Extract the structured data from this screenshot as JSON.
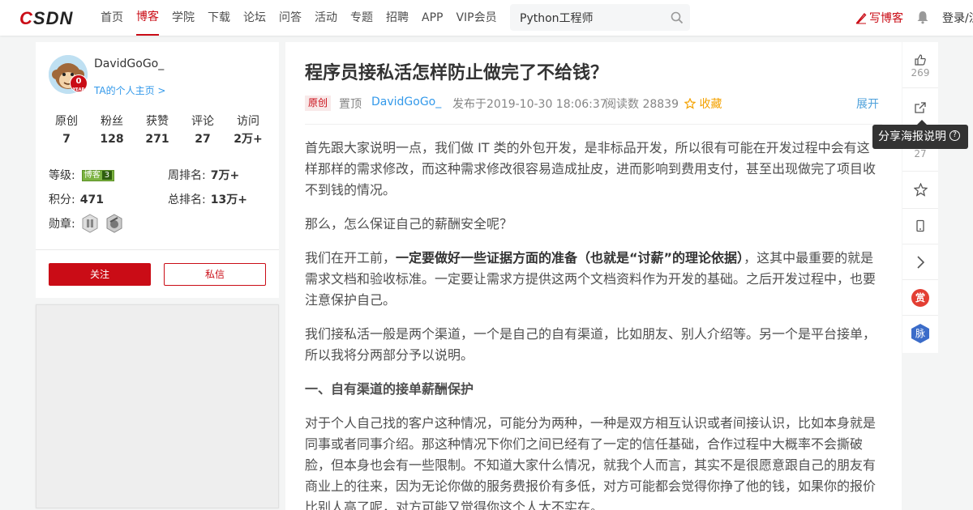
{
  "logo": {
    "text_c": "C",
    "text_sdn": "SDN"
  },
  "nav": {
    "items": [
      {
        "label": "首页"
      },
      {
        "label": "博客"
      },
      {
        "label": "学院"
      },
      {
        "label": "下载"
      },
      {
        "label": "论坛"
      },
      {
        "label": "问答"
      },
      {
        "label": "活动"
      },
      {
        "label": "专题"
      },
      {
        "label": "招聘"
      },
      {
        "label": "APP"
      },
      {
        "label": "VIP会员"
      }
    ],
    "active": "博客"
  },
  "search": {
    "value": "Python工程师"
  },
  "header": {
    "write_label": "写博客",
    "login_label": "登录/注册"
  },
  "profile": {
    "username": "DavidGoGo_",
    "homepage_link": "TA的个人主页 >",
    "year_badge": "0",
    "year_badge_sub": "YEAR",
    "stats": [
      {
        "label": "原创",
        "value": "7"
      },
      {
        "label": "粉丝",
        "value": "128"
      },
      {
        "label": "获赞",
        "value": "271"
      },
      {
        "label": "评论",
        "value": "27"
      },
      {
        "label": "访问",
        "value": "2万+"
      }
    ],
    "level_label": "等级:",
    "level_badge_text": "博客",
    "level_badge_num": "3",
    "weekly_rank_label": "周排名:",
    "weekly_rank": "7万+",
    "points_label": "积分:",
    "points": "471",
    "total_rank_label": "总排名:",
    "total_rank": "13万+",
    "medals_label": "勋章:",
    "follow_label": "关注",
    "message_label": "私信"
  },
  "article": {
    "title": "程序员接私活怎样防止做完了不给钱？",
    "tag": "原创",
    "pinned": "置顶",
    "author": "DavidGoGo_",
    "published": "发布于2019-10-30 18:06:37",
    "reads": "阅读数 28839",
    "collect": "收藏",
    "expand": "展开",
    "p1": "首先跟大家说明一点，我们做 IT 类的外包开发，是非标品开发，所以很有可能在开发过程中会有这样那样的需求修改，而这种需求修改很容易造成扯皮，进而影响到费用支付，甚至出现做完了项目收不到钱的情况。",
    "p2": "那么，怎么保证自己的薪酬安全呢？",
    "p3_pre": "我们在开工前，",
    "p3_bold": "一定要做好一些证据方面的准备（也就是“讨薪”的理论依据）",
    "p3_post": "，这其中最重要的就是需求文档和验收标准。一定要让需求方提供这两个文档资料作为开发的基础。之后开发过程中，也要注意保护自己。",
    "p4": "我们接私活一般是两个渠道，一个是自己的自有渠道，比如朋友、别人介绍等。另一个是平台接单，所以我将分两部分予以说明。",
    "heading1": "一、自有渠道的接单薪酬保护",
    "p5": "对于个人自己找的客户这种情况，可能分为两种，一种是双方相互认识或者间接认识，比如本身就是同事或者同事介绍。那这种情况下你们之间已经有了一定的信任基础，合作过程中大概率不会撕破脸，但本身也会有一些限制。不知道大家什么情况，就我个人而言，其实不是很愿意跟自己的朋友有商业上的往来，因为无论你做的服务费报价有多低，对方可能都会觉得你挣了他的钱，如果你的报价比别人高了呢，对方可能又觉得你这个人太不实在。"
  },
  "toolbar": {
    "like_count": "269",
    "comment_count": "27",
    "share_tooltip": "分享海报说明",
    "reward_label": "赏",
    "mai_label": "脉"
  },
  "colors": {
    "brand": "#ca0c16",
    "link": "#3399ea",
    "collect": "#f4a200"
  }
}
